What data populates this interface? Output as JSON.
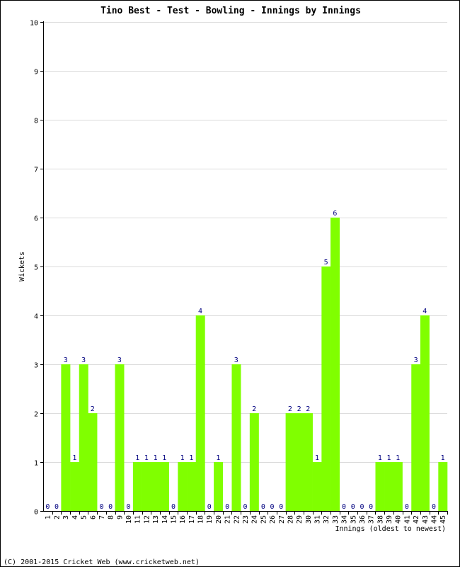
{
  "chart_data": {
    "type": "bar",
    "title": "Tino Best - Test - Bowling - Innings by Innings",
    "xlabel": "Innings (oldest to newest)",
    "ylabel": "Wickets",
    "ylim": [
      0,
      10
    ],
    "yticks": [
      0,
      1,
      2,
      3,
      4,
      5,
      6,
      7,
      8,
      9,
      10
    ],
    "grid": true,
    "categories": [
      "1",
      "2",
      "3",
      "4",
      "5",
      "6",
      "7",
      "8",
      "9",
      "10",
      "11",
      "12",
      "13",
      "14",
      "15",
      "16",
      "17",
      "18",
      "19",
      "20",
      "21",
      "22",
      "23",
      "24",
      "25",
      "26",
      "27",
      "28",
      "29",
      "30",
      "31",
      "32",
      "33",
      "34",
      "35",
      "36",
      "37",
      "38",
      "39",
      "40",
      "41",
      "42",
      "43",
      "44",
      "45"
    ],
    "values": [
      0,
      0,
      3,
      1,
      3,
      2,
      0,
      0,
      3,
      0,
      1,
      1,
      1,
      1,
      0,
      1,
      1,
      4,
      0,
      1,
      0,
      3,
      0,
      2,
      0,
      0,
      0,
      2,
      2,
      2,
      1,
      5,
      6,
      0,
      0,
      0,
      0,
      1,
      1,
      1,
      0,
      3,
      4,
      0,
      1
    ],
    "bar_color": "#80ff00",
    "label_color": "#000080"
  },
  "footer": "(C) 2001-2015 Cricket Web (www.cricketweb.net)"
}
